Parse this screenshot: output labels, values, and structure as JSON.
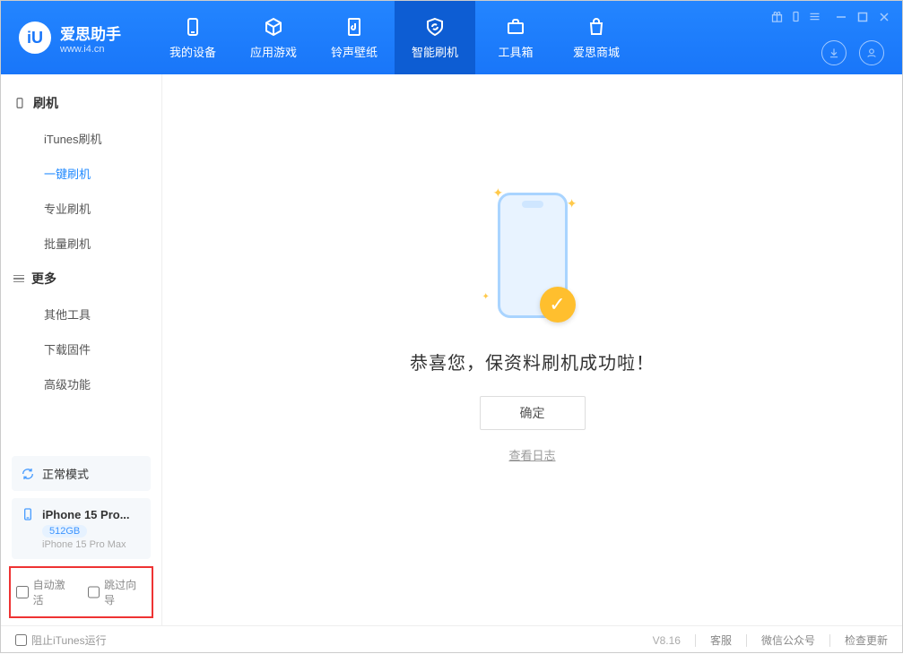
{
  "brand": {
    "title": "爱思助手",
    "subtitle": "www.i4.cn"
  },
  "nav": [
    {
      "label": "我的设备"
    },
    {
      "label": "应用游戏"
    },
    {
      "label": "铃声壁纸"
    },
    {
      "label": "智能刷机",
      "active": true
    },
    {
      "label": "工具箱"
    },
    {
      "label": "爱思商城"
    }
  ],
  "sidebar": {
    "section1": {
      "header": "刷机",
      "items": [
        {
          "label": "iTunes刷机"
        },
        {
          "label": "一键刷机",
          "active": true
        },
        {
          "label": "专业刷机"
        },
        {
          "label": "批量刷机"
        }
      ]
    },
    "section2": {
      "header": "更多",
      "items": [
        {
          "label": "其他工具"
        },
        {
          "label": "下载固件"
        },
        {
          "label": "高级功能"
        }
      ]
    },
    "mode": "正常模式",
    "device": {
      "name": "iPhone 15 Pro...",
      "storage": "512GB",
      "full": "iPhone 15 Pro Max"
    },
    "checkboxes": {
      "autoActivate": "自动激活",
      "skipGuide": "跳过向导"
    }
  },
  "main": {
    "successText": "恭喜您，保资料刷机成功啦！",
    "confirmBtn": "确定",
    "logLink": "查看日志"
  },
  "footer": {
    "blockItunes": "阻止iTunes运行",
    "version": "V8.16",
    "links": [
      "客服",
      "微信公众号",
      "检查更新"
    ]
  }
}
